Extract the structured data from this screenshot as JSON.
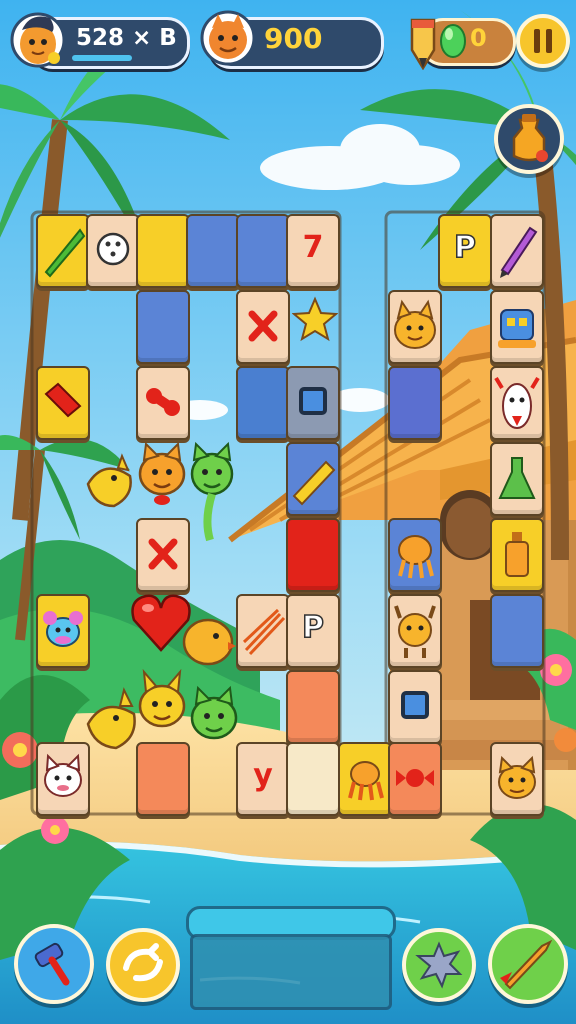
{
  "hud": {
    "player_counter": "528 × B",
    "score": "900",
    "gem_count": "0"
  },
  "board": {
    "tile_glyphs": {
      "seven": "7",
      "letter_p": "P",
      "letter_p2": "P",
      "letter_y": "y",
      "letter_x": "✕"
    }
  },
  "icons": [
    "player-avatar-icon",
    "pause-icon",
    "potion-shop-icon",
    "gem-icon",
    "pencil-icon",
    "hammer-powerup-icon",
    "swap-powerup-icon",
    "splat-powerup-icon",
    "dart-powerup-icon"
  ],
  "colors": {
    "tile_cream": "#f6d6b6",
    "tile_yellow": "#f7cf28",
    "tile_blue": "#5b84d6",
    "tile_red": "#e2231a",
    "tile_orange": "#f4895a",
    "hud_panel": "#2f4a6b"
  }
}
